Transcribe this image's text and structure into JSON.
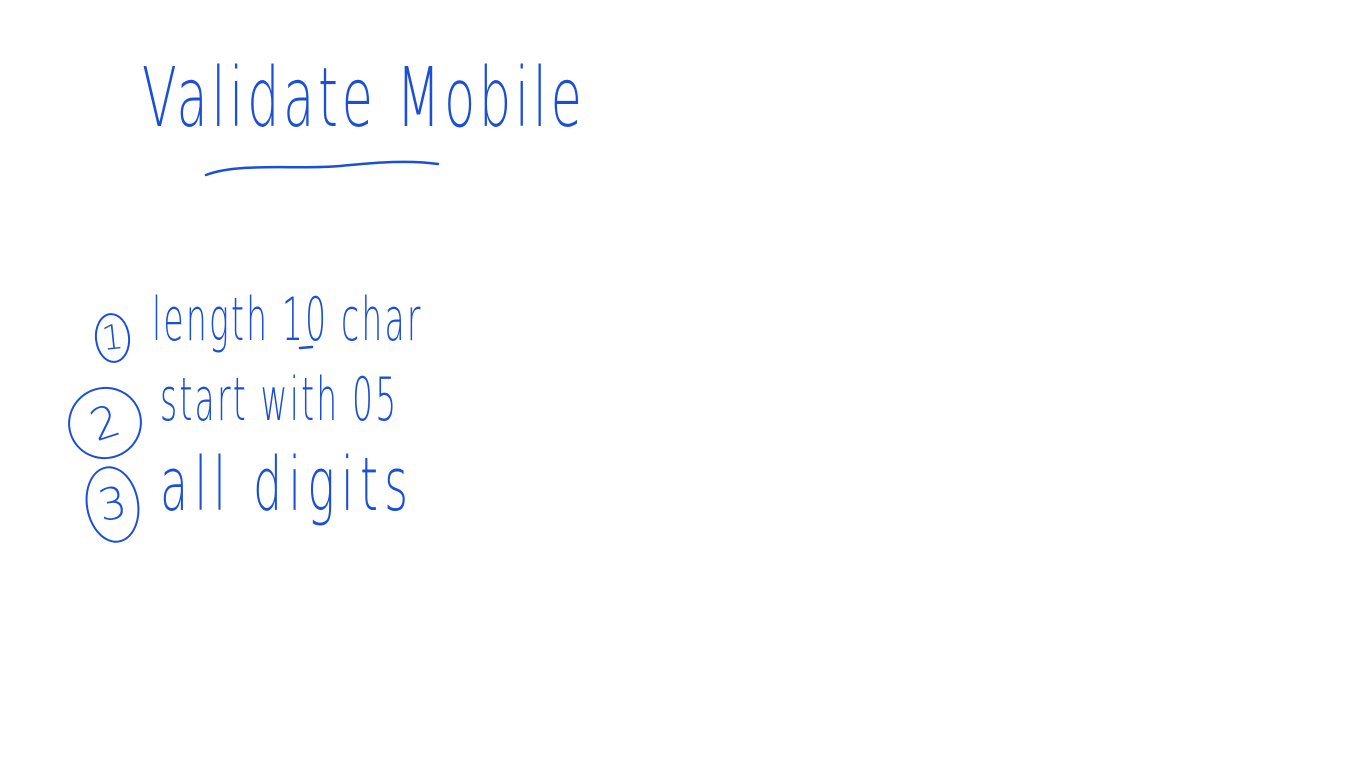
{
  "colors": {
    "ink": "#1b4fd8",
    "background": "#ffffff"
  },
  "note": {
    "title": "Validate Mobile",
    "items": [
      {
        "number": "1",
        "text": "length 10 char"
      },
      {
        "number": "2",
        "text": "start with 05"
      },
      {
        "number": "3",
        "text": "all digits"
      }
    ]
  }
}
